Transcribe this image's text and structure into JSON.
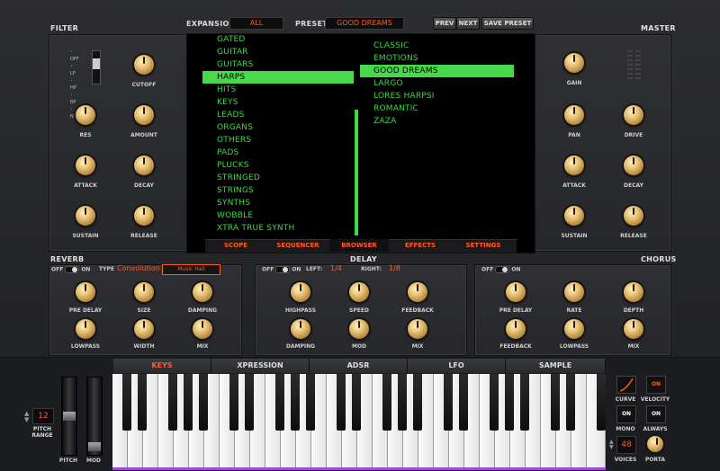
{
  "header": {
    "expansion_label": "EXPANSION",
    "expansion_value": "ALL",
    "preset_label": "PRESET",
    "preset_value": "GOOD DREAMS",
    "prev": "PREV",
    "next": "NEXT",
    "save": "SAVE PRESET"
  },
  "filter": {
    "title": "FILTER",
    "modes": [
      "OFF",
      "LP",
      "HP",
      "BP",
      "NT"
    ],
    "knobs": [
      "CUTOFF",
      "RES",
      "AMOUNT",
      "ATTACK",
      "DECAY",
      "SUSTAIN",
      "RELEASE"
    ]
  },
  "master": {
    "title": "MASTER",
    "knobs": [
      "GAIN",
      "PAN",
      "DRIVE",
      "ATTACK",
      "DECAY",
      "SUSTAIN",
      "RELEASE"
    ]
  },
  "browser": {
    "categories": [
      "GATED",
      "GUITAR",
      "GUITARS",
      "HARPS",
      "HITS",
      "KEYS",
      "LEADS",
      "ORGANS",
      "OTHERS",
      "PADS",
      "PLUCKS",
      "STRINGED",
      "STRINGS",
      "SYNTHS",
      "WOBBLE",
      "XTRA TRUE SYNTH"
    ],
    "presets": [
      "CLASSIC",
      "EMOTIONS",
      "GOOD DREAMS",
      "LARGO",
      "LORES HARPSI",
      "ROMANTIC",
      "ZAZA"
    ],
    "tabs": [
      "SCOPE",
      "SEQUENCER",
      "BROWSER",
      "EFFECTS",
      "SETTINGS"
    ]
  },
  "reverb": {
    "title": "REVERB",
    "off": "OFF",
    "on": "ON",
    "type_label": "TYPE",
    "type_value": "Convolution",
    "room": "Music Hall",
    "knobs": [
      "PRE DELAY",
      "SIZE",
      "DAMPING",
      "LOWPASS",
      "WIDTH",
      "MIX"
    ]
  },
  "delay": {
    "title": "DELAY",
    "off": "OFF",
    "on": "ON",
    "left_label": "LEFT:",
    "left_value": "1/4",
    "right_label": "RIGHT:",
    "right_value": "1/8",
    "knobs": [
      "HIGHPASS",
      "SPEED",
      "FEEDBACK",
      "DAMPING",
      "MOD",
      "MIX"
    ]
  },
  "chorus": {
    "title": "CHORUS",
    "off": "OFF",
    "on": "ON",
    "knobs": [
      "PRE DELAY",
      "RATE",
      "DEPTH",
      "FEEDBACK",
      "LOWPASS",
      "MIX"
    ]
  },
  "bottom": {
    "tabs": [
      "KEYS",
      "XPRESSION",
      "ADSR",
      "LFO",
      "SAMPLE"
    ],
    "pitch_range_value": "12",
    "pitch_range_label": "PITCH\nRANGE",
    "pitch_label": "PITCH",
    "mod_label": "MOD",
    "curve": "CURVE",
    "velocity": "VELOCITY",
    "velocity_on": "ON",
    "mono_on": "ON",
    "mono": "MONO",
    "always_on": "ON",
    "always": "ALWAYS",
    "voices_value": "48",
    "voices": "VOICES",
    "porta": "PORTA"
  },
  "colors": {
    "accent": "#ff5a2a",
    "browser_green": "#3fd84a",
    "knob_gold": "#e7c37a"
  }
}
